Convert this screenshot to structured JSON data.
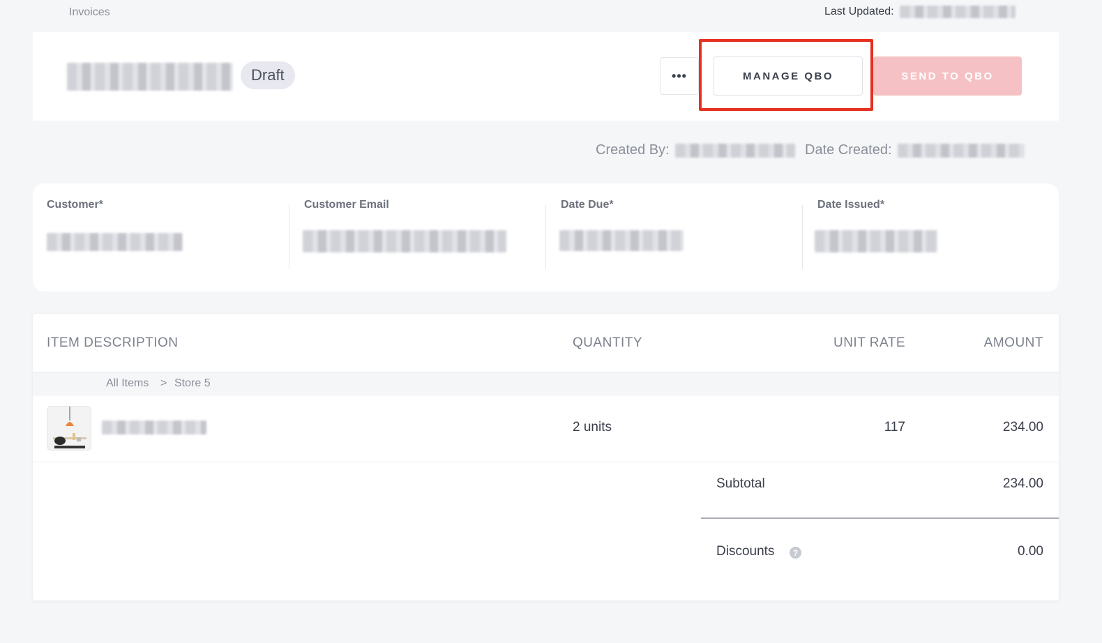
{
  "breadcrumb": {
    "root": "Invoices"
  },
  "header": {
    "last_updated_label": "Last Updated:",
    "status": "Draft",
    "more_label": "•••",
    "manage_label": "MANAGE QBO",
    "send_label": "SEND TO QBO"
  },
  "meta": {
    "created_by_label": "Created By:",
    "date_created_label": "Date Created:"
  },
  "fields": {
    "customer_label": "Customer*",
    "email_label": "Customer Email",
    "due_label": "Date Due*",
    "issued_label": "Date Issued*"
  },
  "table": {
    "headers": [
      "ITEM DESCRIPTION",
      "QUANTITY",
      "UNIT RATE",
      "AMOUNT"
    ],
    "crumbs": [
      "All Items",
      ">",
      "Store 5"
    ],
    "rows": [
      {
        "quantity": "2 units",
        "rate": "117",
        "amount": "234.00"
      }
    ]
  },
  "totals": {
    "subtotal_label": "Subtotal",
    "subtotal_value": "234.00",
    "discounts_label": "Discounts",
    "discounts_value": "0.00",
    "help_glyph": "?"
  },
  "colors": {
    "highlight": "#e5311f",
    "send_button": "#f5c1c4",
    "badge": "#e8e8f0"
  }
}
